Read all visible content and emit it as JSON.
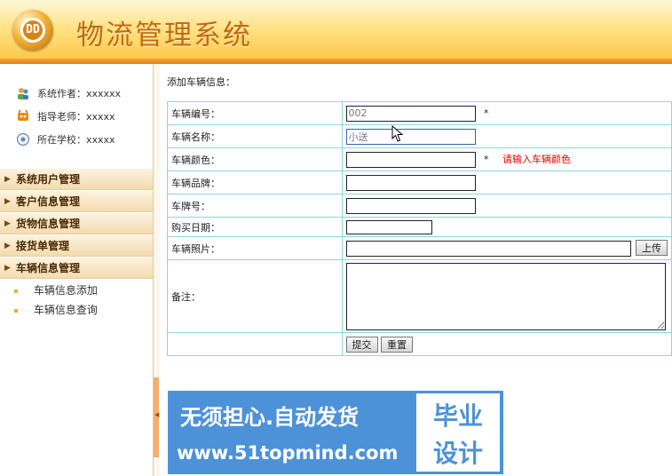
{
  "header": {
    "title": "物流管理系统",
    "logo_text": "DD"
  },
  "sidebar": {
    "info": [
      {
        "icon": "users-icon",
        "label": "系统作者：xxxxxx"
      },
      {
        "icon": "teacher-icon",
        "label": "指导老师：xxxxx"
      },
      {
        "icon": "school-icon",
        "label": "所在学校：xxxxx"
      }
    ],
    "menus": [
      {
        "label": "系统用户管理"
      },
      {
        "label": "客户信息管理"
      },
      {
        "label": "货物信息管理"
      },
      {
        "label": "接货单管理"
      },
      {
        "label": "车辆信息管理"
      }
    ],
    "submenu": [
      {
        "label": "车辆信息添加"
      },
      {
        "label": "车辆信息查询"
      }
    ]
  },
  "main": {
    "section_title": "添加车辆信息：",
    "fields": {
      "vehicle_no": {
        "label": "车辆编号：",
        "value": "002",
        "required": "*"
      },
      "vehicle_name": {
        "label": "车辆名称：",
        "value": "小送"
      },
      "vehicle_color": {
        "label": "车辆颜色：",
        "value": "",
        "required": "*",
        "error": "请输入车辆颜色"
      },
      "vehicle_brand": {
        "label": "车辆品牌：",
        "value": ""
      },
      "plate_no": {
        "label": "车牌号：",
        "value": ""
      },
      "purchase_date": {
        "label": "购买日期：",
        "value": ""
      },
      "photo": {
        "label": "车辆照片：",
        "value": "",
        "upload_label": "上传"
      },
      "remark": {
        "label": "备注：",
        "value": ""
      }
    },
    "buttons": {
      "submit": "提交",
      "reset": "重置"
    }
  },
  "banner": {
    "line1": "无须担心.自动发货",
    "line2": "www.51topmind.com",
    "box1": "毕业",
    "box2": "设计"
  },
  "colors": {
    "accent": "#c46a10",
    "table_border": "#8fd3e0",
    "error": "#e00000",
    "banner": "#4d92d9"
  }
}
